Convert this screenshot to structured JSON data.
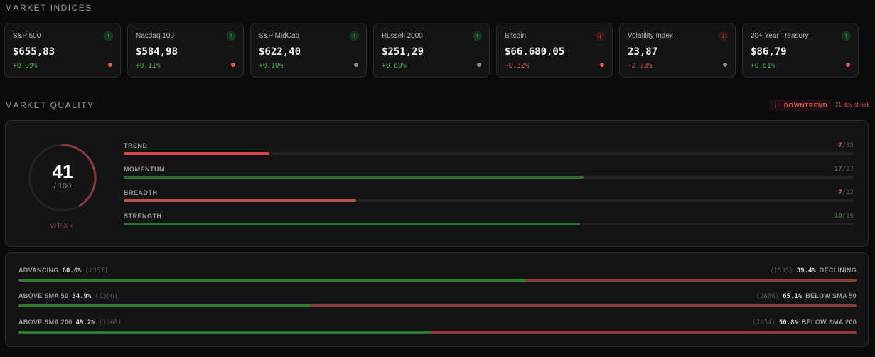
{
  "indices_title": "MARKET INDICES",
  "quality_title": "MARKET QUALITY",
  "indices": [
    {
      "name": "S&P 500",
      "price": "$655,83",
      "change": "+0.09%",
      "dir": "up",
      "dot": "#e05555"
    },
    {
      "name": "Nasdaq 100",
      "price": "$584,98",
      "change": "+0.11%",
      "dir": "up",
      "dot": "#e05555"
    },
    {
      "name": "S&P MidCap",
      "price": "$622,40",
      "change": "+0.10%",
      "dir": "up",
      "dot": "#888888"
    },
    {
      "name": "Russell 2000",
      "price": "$251,29",
      "change": "+0.69%",
      "dir": "up",
      "dot": "#888888"
    },
    {
      "name": "Bitcoin",
      "price": "$66.680,05",
      "change": "-0.32%",
      "dir": "down",
      "dot": "#e05555"
    },
    {
      "name": "Volatility Index",
      "price": "23,87",
      "change": "-2.73%",
      "dir": "down",
      "dot": "#888888"
    },
    {
      "name": "20+ Year Treasury",
      "price": "$86,79",
      "change": "+0.61%",
      "dir": "up",
      "dot": "#e05555"
    }
  ],
  "trend_badge": {
    "arrow": "↓",
    "label": "DOWNTREND",
    "streak": "21-day streak"
  },
  "score": {
    "value": "41",
    "max": "/ 100",
    "label": "WEAK",
    "fraction": 0.41,
    "color": "#8a3a42"
  },
  "metrics": [
    {
      "label": "TREND",
      "num": "7",
      "den": "/35",
      "fraction": 0.2,
      "color": "#d94848",
      "num_color": "#e05555"
    },
    {
      "label": "MOMENTUM",
      "num": "17",
      "den": "/27",
      "fraction": 0.63,
      "color": "#2e6b34",
      "num_color": "#5a5a5a"
    },
    {
      "label": "BREADTH",
      "num": "7",
      "den": "/22",
      "fraction": 0.318,
      "color": "#c05050",
      "num_color": "#e05555"
    },
    {
      "label": "STRENGTH",
      "num": "10",
      "den": "/16",
      "fraction": 0.625,
      "color": "#2e6b34",
      "num_color": "#3d6b40"
    }
  ],
  "breadth": [
    {
      "left_label": "ADVANCING",
      "left_pct": "60.6%",
      "left_cnt": "(2357)",
      "right_cnt": "(1535)",
      "right_pct": "39.4%",
      "right_label": "DECLINING",
      "fraction": 0.606
    },
    {
      "left_label": "ABOVE  SMA 50",
      "left_pct": "34.9%",
      "left_cnt": "(1396)",
      "right_cnt": "(2606)",
      "right_pct": "65.1%",
      "right_label": "BELOW  SMA 50",
      "fraction": 0.349
    },
    {
      "left_label": "ABOVE  SMA 200",
      "left_pct": "49.2%",
      "left_cnt": "(1968)",
      "right_cnt": "(2034)",
      "right_pct": "50.8%",
      "right_label": "BELOW  SMA 200",
      "fraction": 0.492
    }
  ]
}
